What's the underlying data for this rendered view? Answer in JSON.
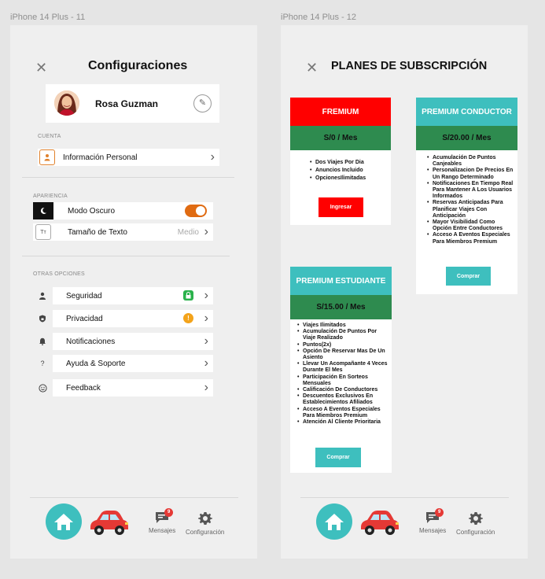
{
  "frames": {
    "left_label": "iPhone 14 Plus - 11",
    "right_label": "iPhone 14 Plus - 12"
  },
  "settings": {
    "title": "Configuraciones",
    "close_icon": "close-icon",
    "profile": {
      "name": "Rosa Guzman"
    },
    "sections": {
      "account": "CUENTA",
      "appearance": "APARIENCIA",
      "other": "OTRAS OPCIONES"
    },
    "account_items": [
      {
        "label": "Información Personal",
        "icon": "person-icon"
      }
    ],
    "appearance_items": [
      {
        "label": "Modo Oscuro",
        "icon": "moon-icon",
        "toggle_on": true
      },
      {
        "label": "Tamaño de Texto",
        "icon": "text-size-icon",
        "icon_text": "Tт",
        "value": "Medio"
      }
    ],
    "other_items": [
      {
        "label": "Seguridad",
        "icon": "user-icon",
        "badge": "lock"
      },
      {
        "label": "Privacidad",
        "icon": "shield-icon",
        "badge": "!"
      },
      {
        "label": "Notificaciones",
        "icon": "bell-icon"
      },
      {
        "label": "Ayuda & Soporte",
        "icon": "help-icon",
        "icon_text": "?"
      },
      {
        "label": "Feedback",
        "icon": "smile-icon"
      }
    ]
  },
  "tabbar": {
    "messages_label": "Mensajes",
    "messages_count": "9",
    "settings_label": "Configuración"
  },
  "plans": {
    "title": "PLANES DE SUBSCRIPCIÓN",
    "freemium": {
      "name": "FREMIUM",
      "price": "S/0 / Mes",
      "features": [
        "Dos Viajes Por Dia",
        "Anuncios Incluido",
        "OpcionesIlimitadas"
      ],
      "button": "Ingresar",
      "color": "#ff0000"
    },
    "driver": {
      "name": "PREMIUM CONDUCTOR",
      "price": "S/20.00 / Mes",
      "features": [
        "Acumulación De Puntos Canjeables",
        "Personalizacion De Precios En Un Rango Determinado",
        "Notificaciones En Tiempo Real Para Mantener A Los Usuarios Informados",
        "Reservas Anticipadas Para Planificar Viajes Con Anticipación",
        "Mayor Visibilidad Como Opción Entre Conductores",
        "Acceso A Eventos Especiales Para Miembros Premium"
      ],
      "button": "Comprar",
      "color": "#3ebfbe"
    },
    "student": {
      "name": "PREMIUM ESTUDIANTE",
      "price": "S/15.00 / Mes",
      "features": [
        "Viajes Ilimitados",
        "Acumulación De Puntos Por Viaje Realizado",
        "Puntos(2x)",
        "Opción De Reservar Mas De Un Asiento",
        "Llevar Un Acompañante 4 Veces Durante El Mes",
        "Participación En Sorteos Mensuales",
        "Calificación De Conductores",
        "Descuentos Exclusivos En Establecimientos Afiliados",
        "Acceso A Eventos Especiales Para Miembros Premium",
        "Atención Al Cliente Prioritaria"
      ],
      "button": "Comprar",
      "color": "#3ebfbe"
    },
    "price_band_color": "#2e8b4f"
  }
}
